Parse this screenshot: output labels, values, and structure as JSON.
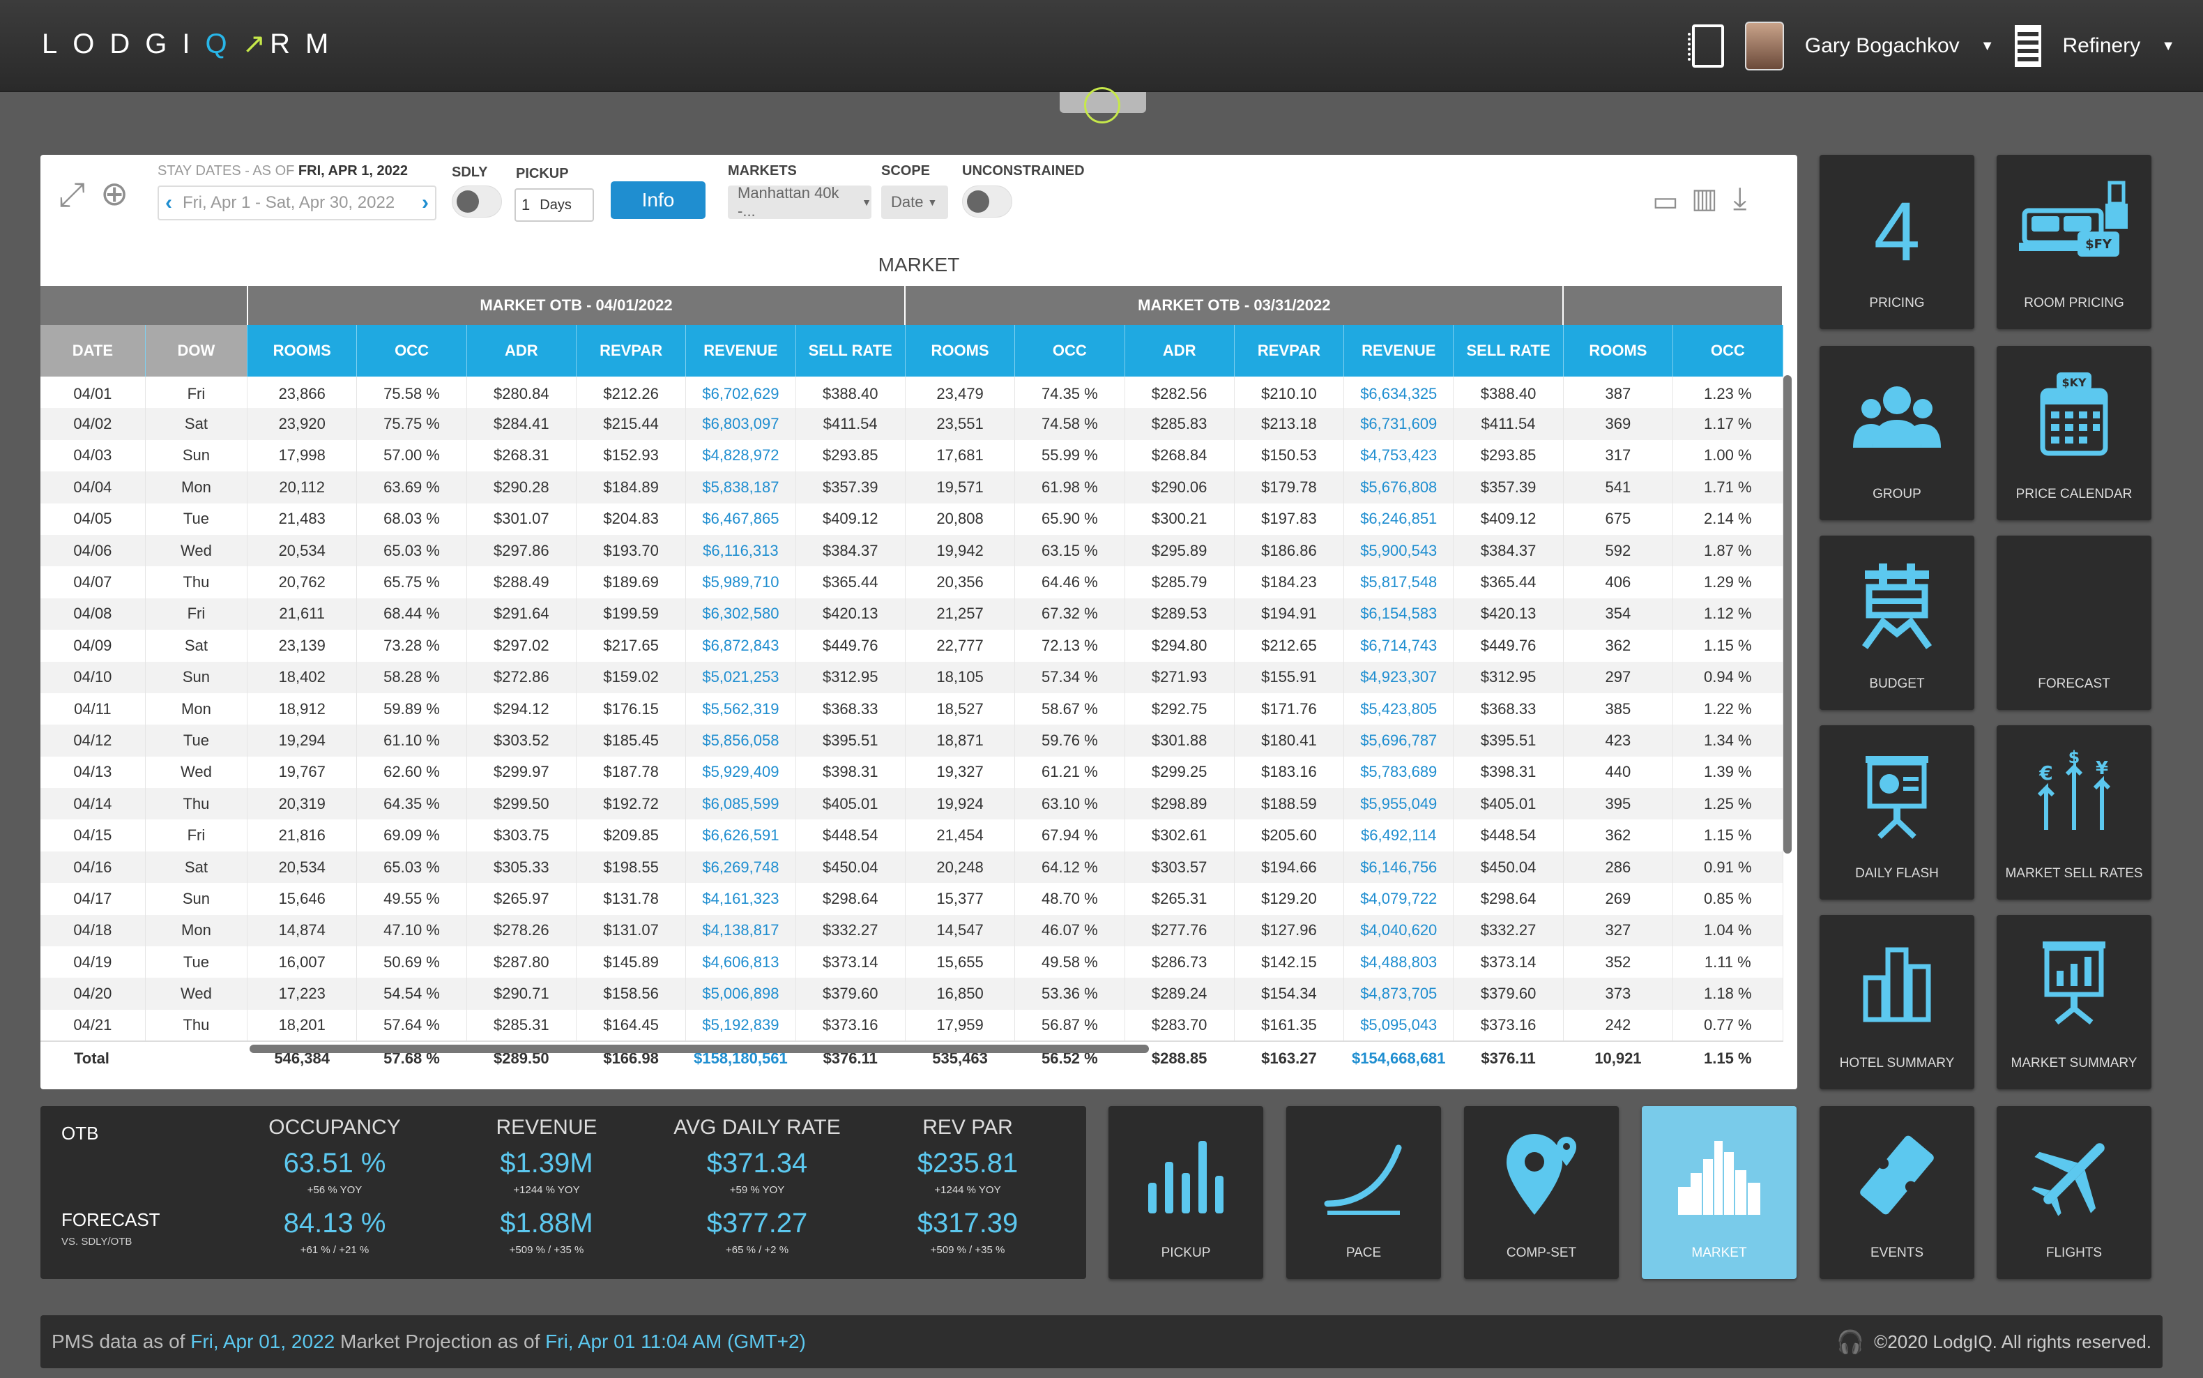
{
  "header": {
    "logo_letters": [
      "L",
      "O",
      "D",
      "G",
      "I"
    ],
    "logo_q": "Q",
    "logo_suffix": "RM",
    "user_name": "Gary Bogachkov",
    "property_name": "Refinery"
  },
  "toolbar": {
    "stay_dates_label": "STAY DATES - AS OF",
    "as_of_date": "FRI, APR 1, 2022",
    "date_range": "Fri, Apr 1 - Sat, Apr 30, 2022",
    "sdly_label": "SDLY",
    "pickup_label": "PICKUP",
    "pickup_value": "1",
    "pickup_unit": "Days",
    "info_button": "Info",
    "markets_label": "MARKETS",
    "markets_value": "Manhattan 40k -...",
    "scope_label": "SCOPE",
    "scope_value": "Date",
    "unconstrained_label": "UNCONSTRAINED"
  },
  "table": {
    "title": "MARKET",
    "group_headers": [
      "MARKET OTB - 04/01/2022",
      "MARKET OTB - 03/31/2022"
    ],
    "columns": [
      "DATE",
      "DOW",
      "ROOMS",
      "OCC",
      "ADR",
      "REVPAR",
      "REVENUE",
      "SELL RATE",
      "ROOMS",
      "OCC",
      "ADR",
      "REVPAR",
      "REVENUE",
      "SELL RATE",
      "ROOMS",
      "OCC"
    ],
    "rows": [
      [
        "04/01",
        "Fri",
        "23,866",
        "75.58 %",
        "$280.84",
        "$212.26",
        "$6,702,629",
        "$388.40",
        "23,479",
        "74.35 %",
        "$282.56",
        "$210.10",
        "$6,634,325",
        "$388.40",
        "387",
        "1.23 %"
      ],
      [
        "04/02",
        "Sat",
        "23,920",
        "75.75 %",
        "$284.41",
        "$215.44",
        "$6,803,097",
        "$411.54",
        "23,551",
        "74.58 %",
        "$285.83",
        "$213.18",
        "$6,731,609",
        "$411.54",
        "369",
        "1.17 %"
      ],
      [
        "04/03",
        "Sun",
        "17,998",
        "57.00 %",
        "$268.31",
        "$152.93",
        "$4,828,972",
        "$293.85",
        "17,681",
        "55.99 %",
        "$268.84",
        "$150.53",
        "$4,753,423",
        "$293.85",
        "317",
        "1.00 %"
      ],
      [
        "04/04",
        "Mon",
        "20,112",
        "63.69 %",
        "$290.28",
        "$184.89",
        "$5,838,187",
        "$357.39",
        "19,571",
        "61.98 %",
        "$290.06",
        "$179.78",
        "$5,676,808",
        "$357.39",
        "541",
        "1.71 %"
      ],
      [
        "04/05",
        "Tue",
        "21,483",
        "68.03 %",
        "$301.07",
        "$204.83",
        "$6,467,865",
        "$409.12",
        "20,808",
        "65.90 %",
        "$300.21",
        "$197.83",
        "$6,246,851",
        "$409.12",
        "675",
        "2.14 %"
      ],
      [
        "04/06",
        "Wed",
        "20,534",
        "65.03 %",
        "$297.86",
        "$193.70",
        "$6,116,313",
        "$384.37",
        "19,942",
        "63.15 %",
        "$295.89",
        "$186.86",
        "$5,900,543",
        "$384.37",
        "592",
        "1.87 %"
      ],
      [
        "04/07",
        "Thu",
        "20,762",
        "65.75 %",
        "$288.49",
        "$189.69",
        "$5,989,710",
        "$365.44",
        "20,356",
        "64.46 %",
        "$285.79",
        "$184.23",
        "$5,817,548",
        "$365.44",
        "406",
        "1.29 %"
      ],
      [
        "04/08",
        "Fri",
        "21,611",
        "68.44 %",
        "$291.64",
        "$199.59",
        "$6,302,580",
        "$420.13",
        "21,257",
        "67.32 %",
        "$289.53",
        "$194.91",
        "$6,154,583",
        "$420.13",
        "354",
        "1.12 %"
      ],
      [
        "04/09",
        "Sat",
        "23,139",
        "73.28 %",
        "$297.02",
        "$217.65",
        "$6,872,843",
        "$449.76",
        "22,777",
        "72.13 %",
        "$294.80",
        "$212.65",
        "$6,714,743",
        "$449.76",
        "362",
        "1.15 %"
      ],
      [
        "04/10",
        "Sun",
        "18,402",
        "58.28 %",
        "$272.86",
        "$159.02",
        "$5,021,253",
        "$312.95",
        "18,105",
        "57.34 %",
        "$271.93",
        "$155.91",
        "$4,923,307",
        "$312.95",
        "297",
        "0.94 %"
      ],
      [
        "04/11",
        "Mon",
        "18,912",
        "59.89 %",
        "$294.12",
        "$176.15",
        "$5,562,319",
        "$368.33",
        "18,527",
        "58.67 %",
        "$292.75",
        "$171.76",
        "$5,423,805",
        "$368.33",
        "385",
        "1.22 %"
      ],
      [
        "04/12",
        "Tue",
        "19,294",
        "61.10 %",
        "$303.52",
        "$185.45",
        "$5,856,058",
        "$395.51",
        "18,871",
        "59.76 %",
        "$301.88",
        "$180.41",
        "$5,696,787",
        "$395.51",
        "423",
        "1.34 %"
      ],
      [
        "04/13",
        "Wed",
        "19,767",
        "62.60 %",
        "$299.97",
        "$187.78",
        "$5,929,409",
        "$398.31",
        "19,327",
        "61.21 %",
        "$299.25",
        "$183.16",
        "$5,783,689",
        "$398.31",
        "440",
        "1.39 %"
      ],
      [
        "04/14",
        "Thu",
        "20,319",
        "64.35 %",
        "$299.50",
        "$192.72",
        "$6,085,599",
        "$405.01",
        "19,924",
        "63.10 %",
        "$298.89",
        "$188.59",
        "$5,955,049",
        "$405.01",
        "395",
        "1.25 %"
      ],
      [
        "04/15",
        "Fri",
        "21,816",
        "69.09 %",
        "$303.75",
        "$209.85",
        "$6,626,591",
        "$448.54",
        "21,454",
        "67.94 %",
        "$302.61",
        "$205.60",
        "$6,492,114",
        "$448.54",
        "362",
        "1.15 %"
      ],
      [
        "04/16",
        "Sat",
        "20,534",
        "65.03 %",
        "$305.33",
        "$198.55",
        "$6,269,748",
        "$450.04",
        "20,248",
        "64.12 %",
        "$303.57",
        "$194.66",
        "$6,146,756",
        "$450.04",
        "286",
        "0.91 %"
      ],
      [
        "04/17",
        "Sun",
        "15,646",
        "49.55 %",
        "$265.97",
        "$131.78",
        "$4,161,323",
        "$298.64",
        "15,377",
        "48.70 %",
        "$265.31",
        "$129.20",
        "$4,079,722",
        "$298.64",
        "269",
        "0.85 %"
      ],
      [
        "04/18",
        "Mon",
        "14,874",
        "47.10 %",
        "$278.26",
        "$131.07",
        "$4,138,817",
        "$332.27",
        "14,547",
        "46.07 %",
        "$277.76",
        "$127.96",
        "$4,040,620",
        "$332.27",
        "327",
        "1.04 %"
      ],
      [
        "04/19",
        "Tue",
        "16,007",
        "50.69 %",
        "$287.80",
        "$145.89",
        "$4,606,813",
        "$373.14",
        "15,655",
        "49.58 %",
        "$286.73",
        "$142.15",
        "$4,488,803",
        "$373.14",
        "352",
        "1.11 %"
      ],
      [
        "04/20",
        "Wed",
        "17,223",
        "54.54 %",
        "$290.71",
        "$158.56",
        "$5,006,898",
        "$379.60",
        "16,850",
        "53.36 %",
        "$289.24",
        "$154.34",
        "$4,873,705",
        "$379.60",
        "373",
        "1.18 %"
      ],
      [
        "04/21",
        "Thu",
        "18,201",
        "57.64 %",
        "$285.31",
        "$164.45",
        "$5,192,839",
        "$373.16",
        "17,959",
        "56.87 %",
        "$283.70",
        "$161.35",
        "$5,095,043",
        "$373.16",
        "242",
        "0.77 %"
      ]
    ],
    "total": [
      "Total",
      "",
      "546,384",
      "57.68 %",
      "$289.50",
      "$166.98",
      "$158,180,561",
      "$376.11",
      "535,463",
      "56.52 %",
      "$288.85",
      "$163.27",
      "$154,668,681",
      "$376.11",
      "10,921",
      "1.15 %"
    ]
  },
  "tiles": {
    "pricing_number": "4",
    "pricing": "PRICING",
    "room_pricing": "ROOM PRICING",
    "group": "GROUP",
    "price_calendar": "PRICE CALENDAR",
    "budget": "BUDGET",
    "forecast": "FORECAST",
    "daily_flash": "DAILY FLASH",
    "market_sell_rates": "MARKET SELL RATES",
    "hotel_summary": "HOTEL SUMMARY",
    "market_summary": "MARKET SUMMARY",
    "pickup": "PICKUP",
    "pace": "PACE",
    "comp_set": "COMP-SET",
    "market": "MARKET",
    "events": "EVENTS",
    "flights": "FLIGHTS"
  },
  "kpi": {
    "otb_label": "OTB",
    "forecast_label": "FORECAST",
    "forecast_sub": "VS. SDLY/OTB",
    "headers": [
      "OCCUPANCY",
      "REVENUE",
      "AVG DAILY RATE",
      "REV PAR"
    ],
    "otb_values": [
      "63.51 %",
      "$1.39M",
      "$371.34",
      "$235.81"
    ],
    "otb_sub": [
      "+56 % YOY",
      "+1244 % YOY",
      "+59 % YOY",
      "+1244 % YOY"
    ],
    "forecast_values": [
      "84.13 %",
      "$1.88M",
      "$377.27",
      "$317.39"
    ],
    "forecast_sub_vals": [
      "+61 % / +21 %",
      "+509 % / +35 %",
      "+65 % / +2 %",
      "+509 % / +35 %"
    ]
  },
  "footer": {
    "pms_prefix": "PMS data as of",
    "pms_date": "Fri, Apr 01, 2022",
    "proj_prefix": "Market Projection as of",
    "proj_date": "Fri, Apr 01 11:04 AM (GMT+2)",
    "copyright": "©2020 LodgIQ. All rights reserved."
  },
  "colors": {
    "accent": "#1fa9e1",
    "tile_bg": "#2c2c2c",
    "tile_icon": "#5cc8ef",
    "active_tile": "#79cbea"
  }
}
